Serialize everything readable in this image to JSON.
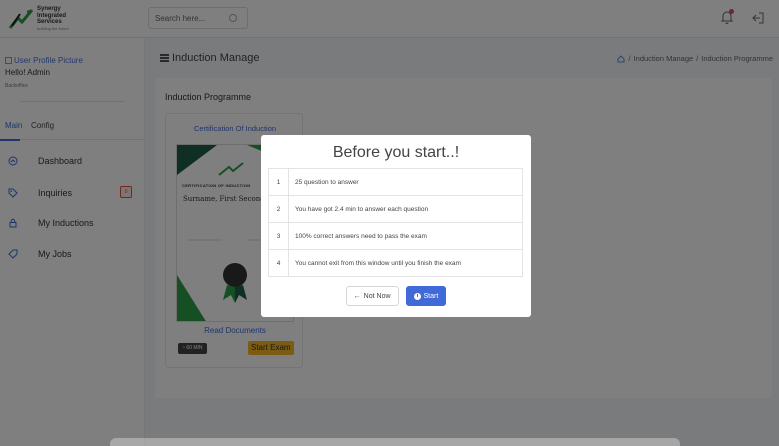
{
  "header": {
    "logo_lines": [
      "Synergy",
      "Integrated",
      "Services"
    ],
    "logo_sub": "building the future",
    "search_placeholder": "Search here...",
    "colors": {
      "accent": "#3f6ad8",
      "notification_dot": "#e83e8c"
    }
  },
  "sidebar": {
    "profile_picture_alt": "User Profile Picture",
    "greeting": "Hello! Admin",
    "role": "Backoffice",
    "tabs": [
      {
        "label": "Main",
        "active": true
      },
      {
        "label": "Config",
        "active": false
      }
    ],
    "items": [
      {
        "label": "Dashboard",
        "icon": "dashboard-icon"
      },
      {
        "label": "Inquiries",
        "icon": "tag-icon",
        "badge": "0"
      },
      {
        "label": "My Inductions",
        "icon": "lock-icon"
      },
      {
        "label": "My Jobs",
        "icon": "tag-outline-icon"
      }
    ]
  },
  "main": {
    "page_title": "Induction Manage",
    "breadcrumb": [
      "Induction Manage",
      "Induction Programme"
    ],
    "breadcrumb_separator": "/",
    "section_title": "Induction Programme",
    "course": {
      "title": "Certification Of Induction",
      "certificate_heading": "CERTIFICATION OF INDUCTION",
      "certificate_name": "Surname, First Second",
      "read_documents": "Read Documents",
      "duration": "60 MIN",
      "start_exam": "Start Exam"
    }
  },
  "modal": {
    "title": "Before you start..!",
    "rules": [
      {
        "num": "1",
        "text": "25 question to answer"
      },
      {
        "num": "2",
        "text": "You have got 2.4 min to answer each question"
      },
      {
        "num": "3",
        "text": "100% correct answers need to pass the exam"
      },
      {
        "num": "4",
        "text": "You cannot exit from this window until you finish the exam"
      }
    ],
    "not_now_label": "Not Now",
    "start_label": "Start"
  }
}
